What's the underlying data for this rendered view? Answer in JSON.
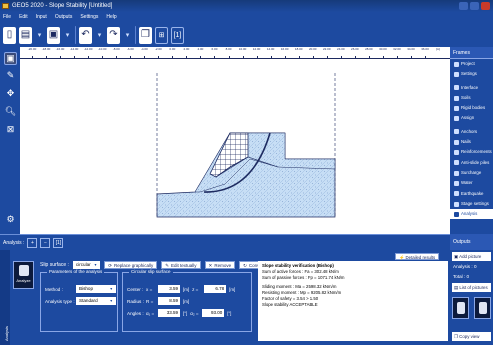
{
  "window": {
    "title": "GEO5 2020 - Slope Stability [Untitled]"
  },
  "menu": [
    "File",
    "Edit",
    "Input",
    "Outputs",
    "Settings",
    "Help"
  ],
  "ruler": {
    "ticks": [
      "-20.00",
      "-18.00",
      "-16.00",
      "-14.00",
      "-12.00",
      "-10.00",
      "-8.00",
      "-6.00",
      "-4.00",
      "-2.00",
      "0.00",
      "2.00",
      "4.00",
      "6.00",
      "8.00",
      "10.00",
      "12.00",
      "14.00",
      "16.00",
      "18.00",
      "20.00",
      "22.00",
      "24.00",
      "26.00",
      "28.00",
      "30.00",
      "32.00",
      "34.00",
      "36.00"
    ],
    "unit": "[m]"
  },
  "right_panel": {
    "header": "Frames",
    "items": [
      "Project",
      "Settings",
      "Interface",
      "Soils",
      "Rigid bodies",
      "Assign",
      "Anchors",
      "Nails",
      "Reinforcements",
      "Anti-slide piles",
      "Surcharge",
      "Water",
      "Earthquake",
      "Stage settings",
      "Analysis"
    ],
    "selected": "Analysis"
  },
  "bottombar": {
    "label": "Analysis :",
    "buttons": [
      "+",
      "−",
      "[1]"
    ]
  },
  "analysis": {
    "analyze_button": "Analyze",
    "slip_surface_label": "Slip surface :",
    "slip_surface_value": "circular",
    "replace_graphically": "Replace graphically",
    "edit_textually": "Edit textually",
    "remove": "Remove",
    "convert_polygon": "Convert to polygon",
    "detailed_results": "Detailed results",
    "params_title": "Parameters of the analysis",
    "method_label": "Method :",
    "method_value": "Bishop",
    "analysis_type_label": "Analysis type :",
    "analysis_type_value": "Standard",
    "slip_title": "Circular slip surface",
    "center_label": "Center :",
    "x_label": "x =",
    "x_value": "3.59",
    "z_label": "z =",
    "z_value": "6.78",
    "radius_label": "Radius :",
    "r_label": "R =",
    "r_value": "8.59",
    "angles_label": "Angles :",
    "a1_label": "α₁ =",
    "a1_value": "33.59",
    "a2_label": "α₂ =",
    "a2_value": "93.00",
    "unit_m": "[m]",
    "unit_deg": "[°]"
  },
  "results": {
    "title": "Slope stability verification (Bishop)",
    "active": "Sum of active forces :   Fa =   302.48  kN/m",
    "passive": "Sum of passive forces :  Fp = 1071.74  kN/m",
    "sliding": "Sliding moment :       Ma = 2598.32  kNm/m",
    "resisting": "Resisting moment :     Mp = 9205.82  kNm/m",
    "fos": "Factor of safety = 3.54 > 1.50",
    "verdict": "Slope stability ACCEPTABLE"
  },
  "outputs": {
    "header": "Outputs",
    "add_picture": "Add picture",
    "analysis_label": "Analysis :",
    "analysis_count": "0",
    "total_label": "Total :",
    "total_count": "0",
    "list_pictures": "List of pictures",
    "copy_view": "Copy view"
  },
  "colors": {
    "accent": "#1d4aa0",
    "soil": "#bcd8f4",
    "grid": "#1d2a60"
  }
}
